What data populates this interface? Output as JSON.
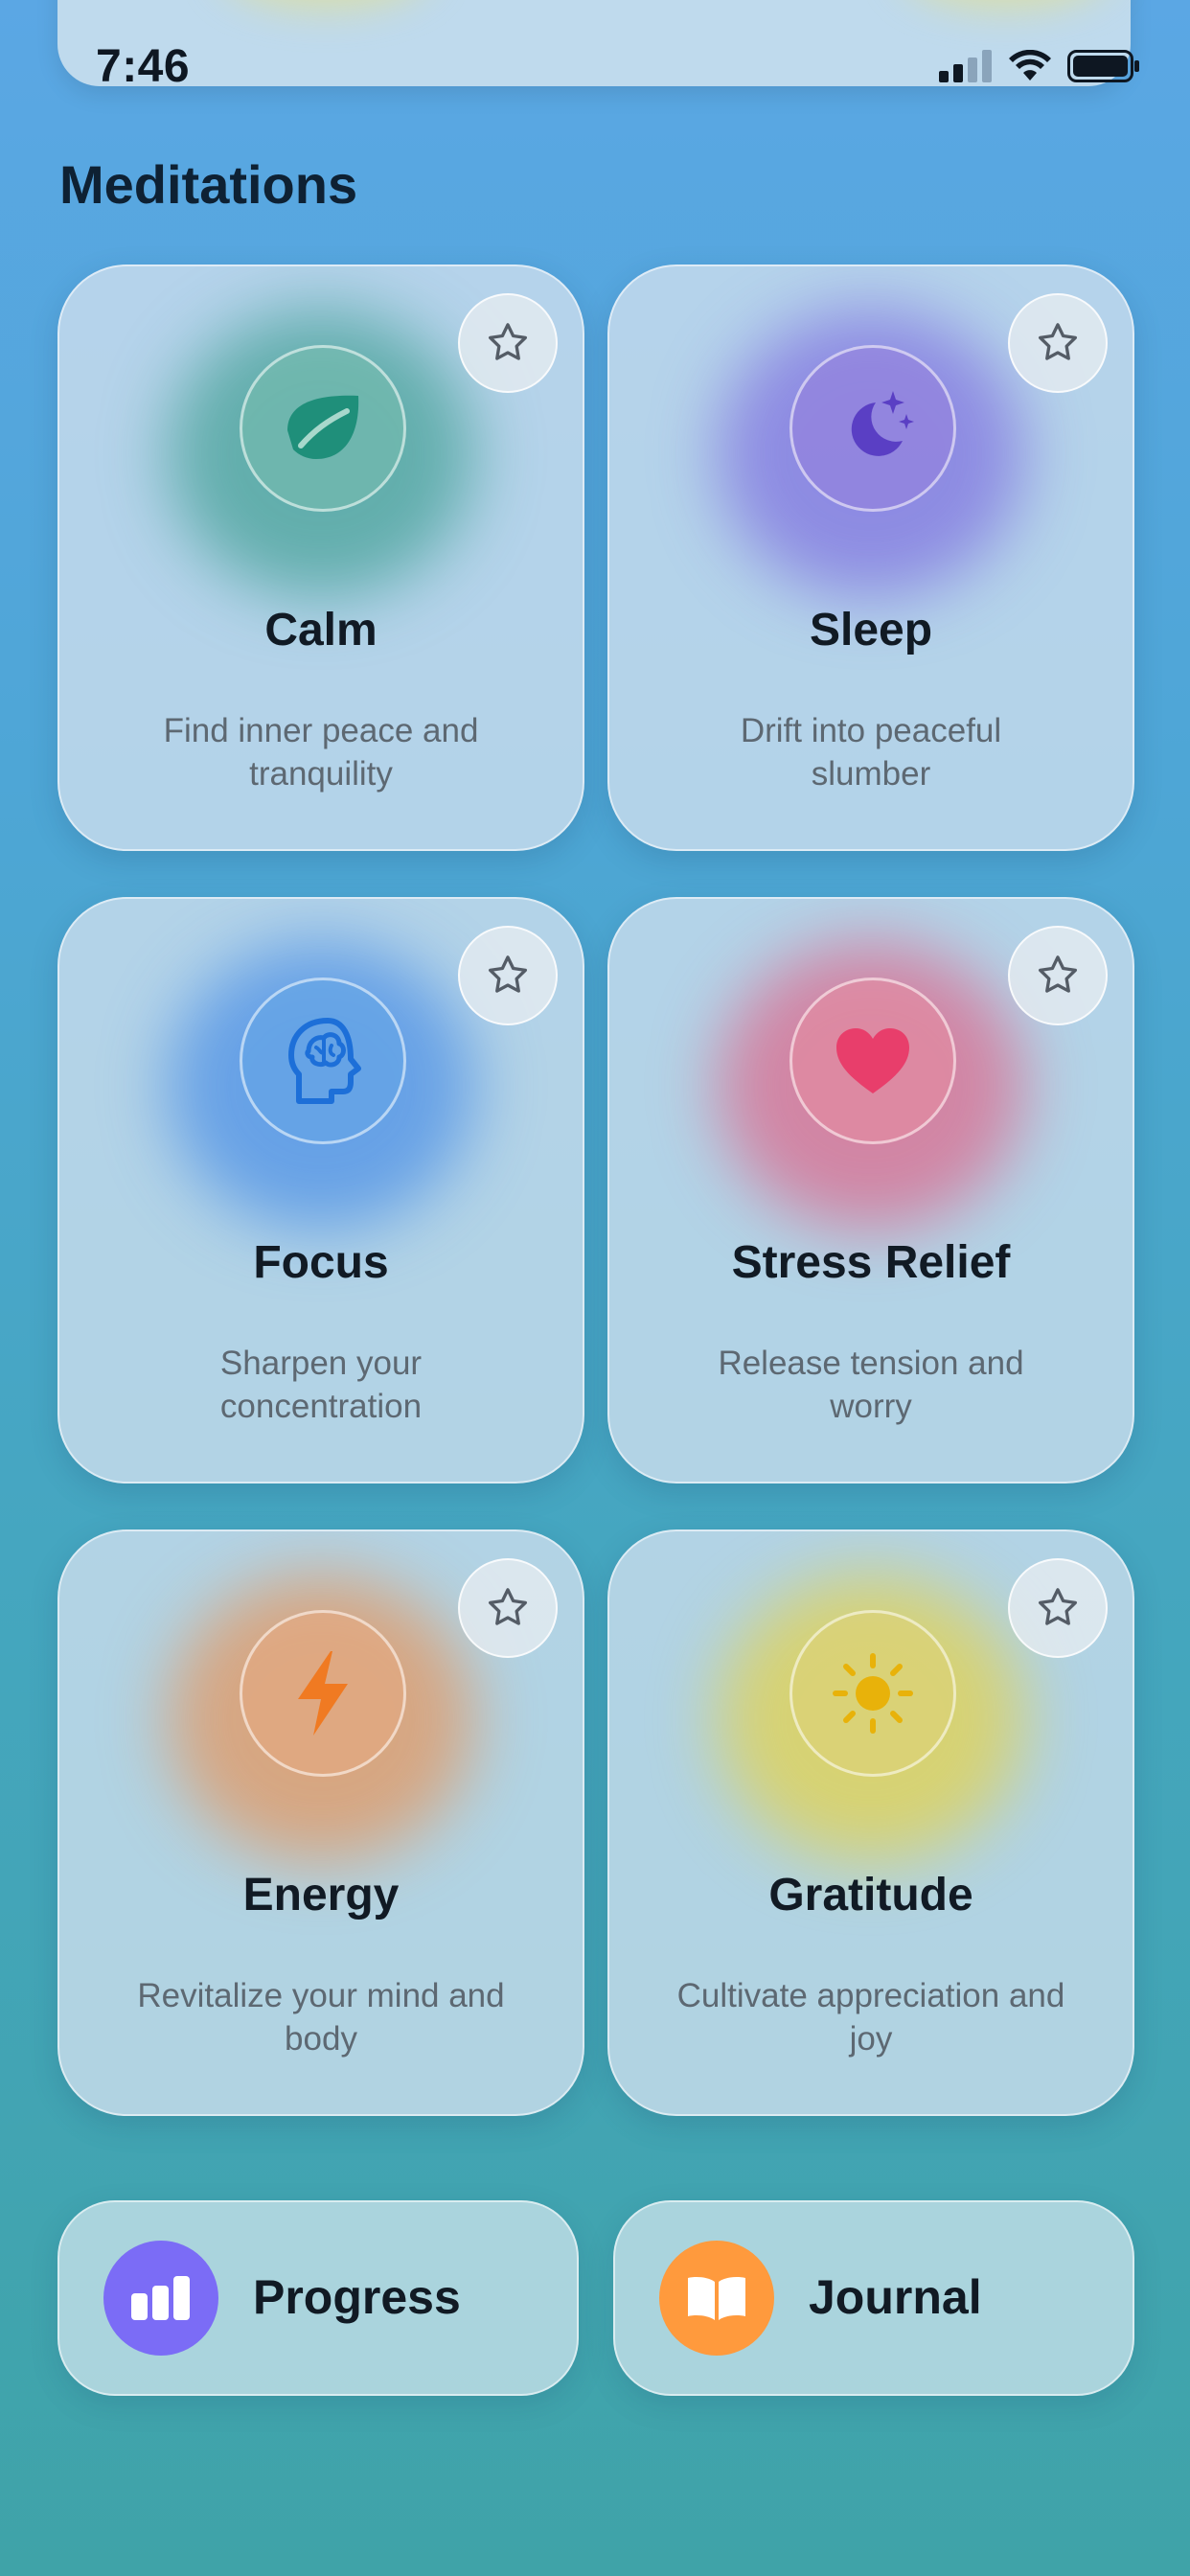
{
  "status_bar": {
    "time": "7:46"
  },
  "section": {
    "title": "Meditations"
  },
  "cards": [
    {
      "title": "Calm",
      "description": "Find inner peace and tranquility",
      "icon": "leaf-icon",
      "color": "#1f8f7a"
    },
    {
      "title": "Sleep",
      "description": "Drift into peaceful slumber",
      "icon": "moon-stars-icon",
      "color": "#5a3fc4"
    },
    {
      "title": "Focus",
      "description": "Sharpen your concentration",
      "icon": "brain-head-icon",
      "color": "#1d6fd8"
    },
    {
      "title": "Stress Relief",
      "description": "Release tension and worry",
      "icon": "heart-icon",
      "color": "#e83e6b"
    },
    {
      "title": "Energy",
      "description": "Revitalize your mind and body",
      "icon": "lightning-icon",
      "color": "#f07a22"
    },
    {
      "title": "Gratitude",
      "description": "Cultivate appreciation and joy",
      "icon": "sun-icon",
      "color": "#e8b20a"
    }
  ],
  "nav": {
    "progress": {
      "label": "Progress",
      "icon": "bar-chart-icon",
      "color": "#7b6cf6"
    },
    "journal": {
      "label": "Journal",
      "icon": "book-icon",
      "color": "#ff9a3d"
    }
  }
}
